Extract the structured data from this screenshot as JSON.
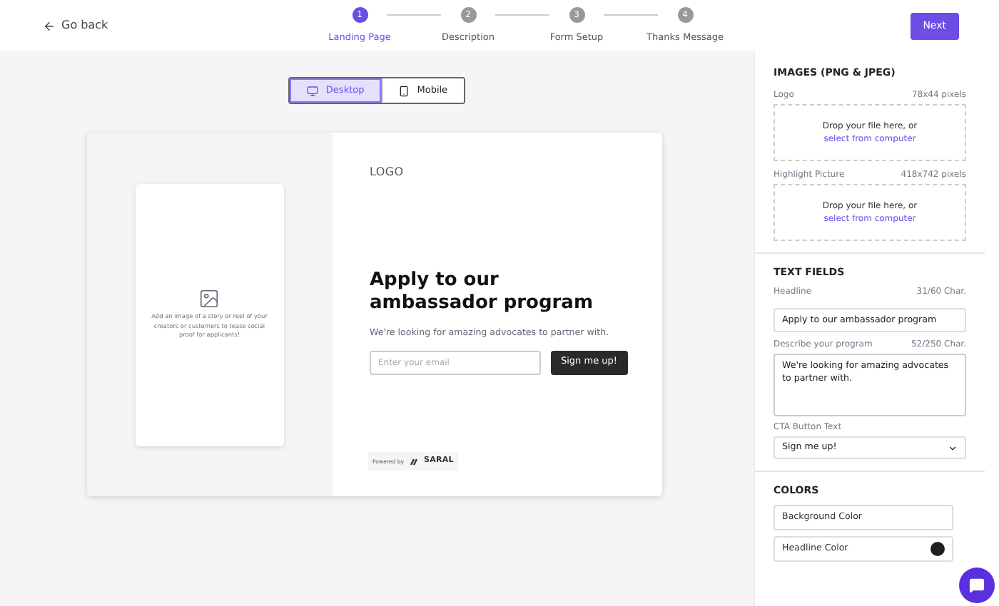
{
  "header": {
    "back": "Go back",
    "next": "Next"
  },
  "steps": [
    {
      "number": "1",
      "label": "Landing Page",
      "selected": true
    },
    {
      "number": "2",
      "label": "Description",
      "selected": false
    },
    {
      "number": "3",
      "label": "Form Setup",
      "selected": false
    },
    {
      "number": "4",
      "label": "Thanks Message",
      "selected": false
    }
  ],
  "view_toggle": [
    {
      "label": "Desktop",
      "kind": "desktop",
      "selected": true
    },
    {
      "label": "Mobile",
      "kind": "mobile",
      "selected": false
    }
  ],
  "preview": {
    "image_hint": "Add an image of a story or reel of your creators or customers to tease social proof for applicants!",
    "logo": "LOGO",
    "headline": "Apply to our ambassador program",
    "description": "We're looking for amazing advocates to partner with.",
    "email_placeholder": "Enter your email",
    "cta": "Sign me up!",
    "powered_by": "Powered by",
    "brand": "SARAL"
  },
  "images": {
    "title": "IMAGES (PNG & JPEG)",
    "uploads": [
      {
        "label": "Logo",
        "size": "78x44 pixels",
        "drop": "Drop your file here, or",
        "link": "select from computer"
      },
      {
        "label": "Highlight Picture",
        "size": "418x742 pixels",
        "drop": "Drop your file here, or",
        "link": "select from computer"
      }
    ]
  },
  "text_fields": {
    "title": "TEXT FIELDS",
    "headline": {
      "label": "Headline",
      "count": "31/60 Char.",
      "value": "Apply to our ambassador program"
    },
    "description": {
      "label": "Describe your program",
      "count": "52/250 Char.",
      "value": "We're looking for amazing advocates to partner with."
    },
    "cta": {
      "label": "CTA Button Text",
      "value": "Sign me up!"
    }
  },
  "colors": {
    "title": "COLORS",
    "items": [
      {
        "label": "Background Color"
      },
      {
        "label": "Headline Color",
        "color": "#1f1f1f"
      }
    ]
  }
}
